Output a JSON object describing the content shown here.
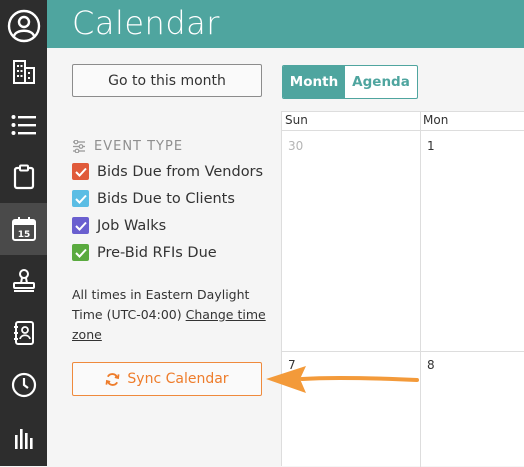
{
  "header": {
    "title": "Calendar"
  },
  "nav": {
    "items": [
      {
        "icon": "user-circle-icon"
      },
      {
        "icon": "building-icon"
      },
      {
        "icon": "list-icon"
      },
      {
        "icon": "clipboard-icon"
      },
      {
        "icon": "calendar-icon",
        "label": "15",
        "active": true
      },
      {
        "icon": "stamp-icon"
      },
      {
        "icon": "contacts-book-icon"
      },
      {
        "icon": "clock-icon"
      },
      {
        "icon": "bar-chart-icon"
      }
    ]
  },
  "sidebar": {
    "go_month_label": "Go to this month",
    "event_type_label": "EVENT TYPE",
    "filters": [
      {
        "label": "Bids Due from Vendors",
        "color": "#e05a3a"
      },
      {
        "label": "Bids Due to Clients",
        "color": "#5bbde4"
      },
      {
        "label": "Job Walks",
        "color": "#6a5fcf"
      },
      {
        "label": "Pre-Bid RFIs Due",
        "color": "#5aaa3f"
      }
    ],
    "timezone_text": "All times in Eastern Daylight Time (UTC-04:00)",
    "timezone_link": "Change time zone",
    "sync_label": "Sync Calendar"
  },
  "view_toggle": {
    "month_label": "Month",
    "agenda_label": "Agenda",
    "selected": "Month"
  },
  "calendar": {
    "day_headers": [
      "Sun",
      "Mon"
    ],
    "week1": [
      "30",
      "1"
    ],
    "week2": [
      "7",
      "8"
    ]
  },
  "colors": {
    "accent": "#4fa59f",
    "sync_orange": "#ee7d2c",
    "nav_bg": "#2d2d2d"
  }
}
